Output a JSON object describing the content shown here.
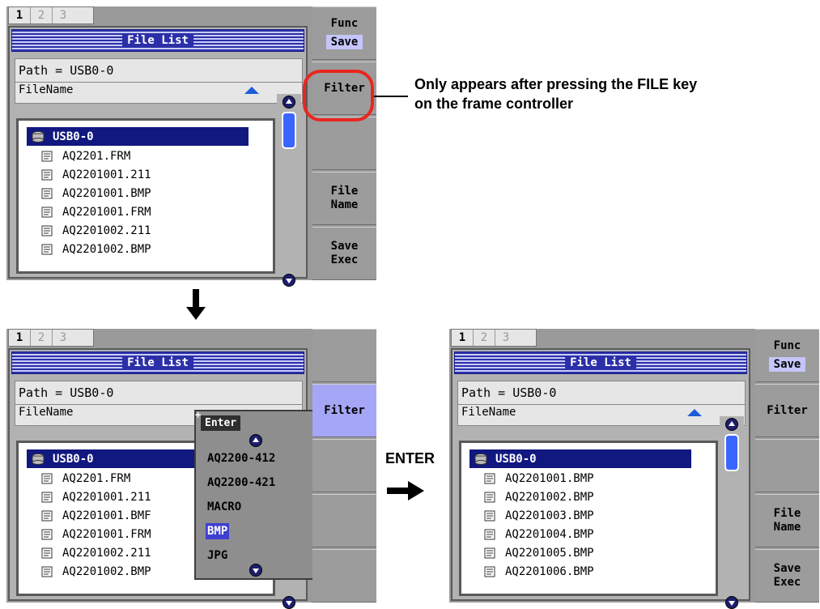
{
  "annotation": {
    "note_line1": "Only appears after pressing the FILE key",
    "note_line2": "on the frame controller",
    "enter_label": "ENTER"
  },
  "common": {
    "tabs": [
      "1",
      "2",
      "3"
    ],
    "title": "File List",
    "path": "Path = USB0-0",
    "filename_header": "FileName",
    "root": "USB0-0"
  },
  "screen1": {
    "files": [
      "AQ2201.FRM",
      "AQ2201001.211",
      "AQ2201001.BMP",
      "AQ2201001.FRM",
      "AQ2201002.211",
      "AQ2201002.BMP"
    ],
    "softkeys": {
      "func": "Func",
      "save": "Save",
      "filter": "Filter",
      "file_name_1": "File",
      "file_name_2": "Name",
      "save_exec_1": "Save",
      "save_exec_2": "Exec"
    }
  },
  "screen2": {
    "files": [
      "AQ2201.FRM",
      "AQ2201001.211",
      "AQ2201001.BMF",
      "AQ2201001.FRM",
      "AQ2201002.211",
      "AQ2201002.BMP"
    ],
    "softkeys": {
      "filter": "Filter"
    },
    "popup": {
      "enter": "Enter",
      "options": [
        "AQ2200-412",
        "AQ2200-421",
        "MACRO",
        "BMP",
        "JPG"
      ],
      "selected": "BMP"
    }
  },
  "screen3": {
    "files": [
      "AQ2201001.BMP",
      "AQ2201002.BMP",
      "AQ2201003.BMP",
      "AQ2201004.BMP",
      "AQ2201005.BMP",
      "AQ2201006.BMP"
    ],
    "softkeys": {
      "func": "Func",
      "save": "Save",
      "filter": "Filter",
      "file_name_1": "File",
      "file_name_2": "Name",
      "save_exec_1": "Save",
      "save_exec_2": "Exec"
    }
  },
  "colors": {
    "accent": "#2b2fa8",
    "selection": "#111880",
    "softkey_selected": "#a6a6f7",
    "callout": "#e8271f"
  },
  "icons": [
    "drive-icon",
    "file-icon",
    "sort-arrow-up-icon",
    "scroll-up-icon",
    "scroll-down-icon",
    "arrow-down-icon",
    "arrow-right-icon"
  ]
}
